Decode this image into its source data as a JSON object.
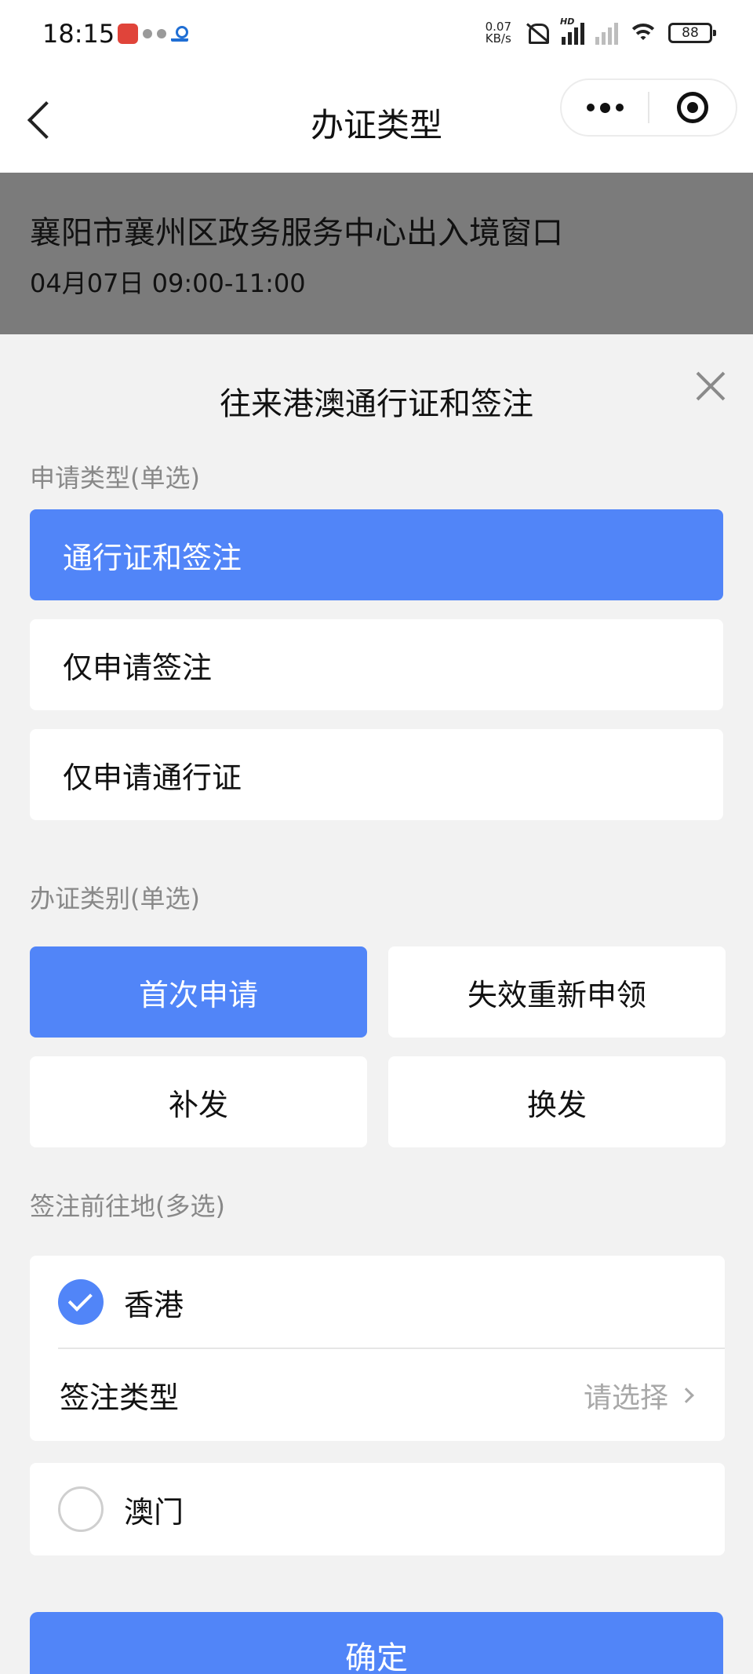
{
  "status_bar": {
    "time": "18:15",
    "net_speed_value": "0.07",
    "net_speed_unit": "KB/s",
    "hd_label": "HD",
    "battery": "88"
  },
  "nav": {
    "title": "办证类型"
  },
  "header": {
    "office": "襄阳市襄州区政务服务中心出入境窗口",
    "time_slot": "04月07日 09:00-11:00"
  },
  "sheet": {
    "title": "往来港澳通行证和签注",
    "apply_type": {
      "label": "申请类型(单选)",
      "options": [
        "通行证和签注",
        "仅申请签注",
        "仅申请通行证"
      ],
      "selected": "通行证和签注"
    },
    "category": {
      "label": "办证类别(单选)",
      "options": [
        "首次申请",
        "失效重新申领",
        "补发",
        "换发"
      ],
      "selected": "首次申请"
    },
    "destination": {
      "label": "签注前往地(多选)",
      "hongkong": "香港",
      "hongkong_checked": true,
      "endorse_type_label": "签注类型",
      "endorse_type_placeholder": "请选择",
      "macau": "澳门",
      "macau_checked": false
    },
    "confirm": "确定"
  },
  "colors": {
    "accent": "#5185f8",
    "overlay": "#7b7b7b",
    "background": "#f2f2f2"
  }
}
